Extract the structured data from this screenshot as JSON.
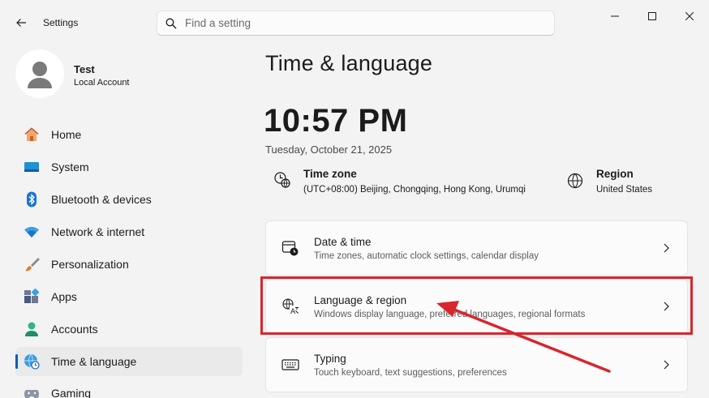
{
  "app": {
    "title": "Settings"
  },
  "search": {
    "placeholder": "Find a setting"
  },
  "profile": {
    "name": "Test",
    "account_type": "Local Account"
  },
  "sidebar": {
    "items": [
      {
        "label": "Home",
        "icon": "home-icon"
      },
      {
        "label": "System",
        "icon": "system-icon"
      },
      {
        "label": "Bluetooth & devices",
        "icon": "bluetooth-icon"
      },
      {
        "label": "Network & internet",
        "icon": "wifi-icon"
      },
      {
        "label": "Personalization",
        "icon": "brush-icon"
      },
      {
        "label": "Apps",
        "icon": "apps-icon"
      },
      {
        "label": "Accounts",
        "icon": "accounts-icon"
      },
      {
        "label": "Time & language",
        "icon": "globe-clock-icon",
        "active": true
      },
      {
        "label": "Gaming",
        "icon": "gamepad-icon"
      }
    ]
  },
  "main": {
    "title": "Time & language",
    "time": "10:57 PM",
    "date": "Tuesday, October 21, 2025",
    "time_zone": {
      "title": "Time zone",
      "value": "(UTC+08:00) Beijing, Chongqing, Hong Kong, Urumqi"
    },
    "region": {
      "title": "Region",
      "value": "United States"
    },
    "cards": [
      {
        "title": "Date & time",
        "subtitle": "Time zones, automatic clock settings, calendar display",
        "icon": "calendar-clock-icon"
      },
      {
        "title": "Language & region",
        "subtitle": "Windows display language, preferred languages, regional formats",
        "icon": "language-icon"
      },
      {
        "title": "Typing",
        "subtitle": "Touch keyboard, text suggestions, preferences",
        "icon": "keyboard-icon"
      }
    ]
  },
  "colors": {
    "accent": "#005fb8",
    "annotation": "#d7262e"
  }
}
